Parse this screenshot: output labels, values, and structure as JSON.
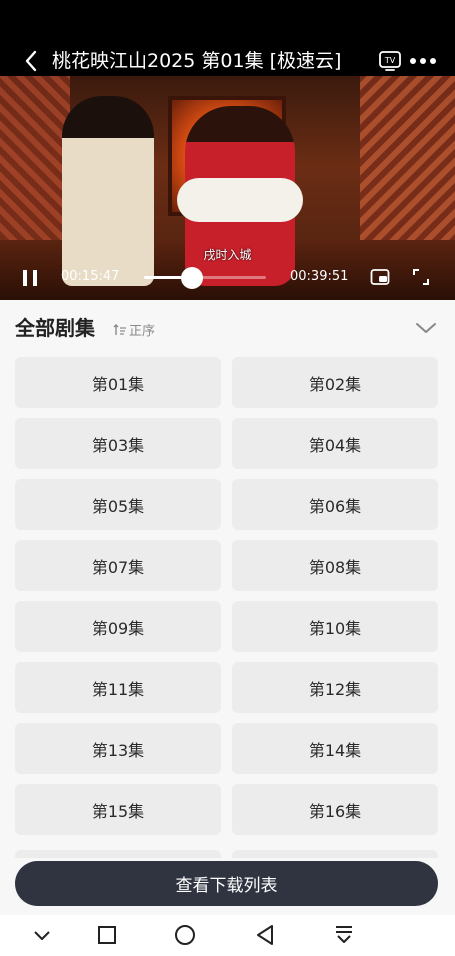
{
  "player": {
    "title": "桃花映江山2025 第01集 [极速云]",
    "subtitle_text": "戌时入城",
    "current_time": "00:15:47",
    "total_time": "00:39:51",
    "progress_fraction": 0.396,
    "icons": {
      "back": "chevron-left-icon",
      "tv": "tv-cast-icon",
      "more": "more-dots-icon",
      "pause": "pause-icon",
      "pip": "picture-in-picture-icon",
      "fullscreen": "fullscreen-icon"
    }
  },
  "episodes": {
    "header": "全部剧集",
    "sort_label": "正序",
    "items": [
      {
        "label": "第01集"
      },
      {
        "label": "第02集"
      },
      {
        "label": "第03集"
      },
      {
        "label": "第04集"
      },
      {
        "label": "第05集"
      },
      {
        "label": "第06集"
      },
      {
        "label": "第07集"
      },
      {
        "label": "第08集"
      },
      {
        "label": "第09集"
      },
      {
        "label": "第10集"
      },
      {
        "label": "第11集"
      },
      {
        "label": "第12集"
      },
      {
        "label": "第13集"
      },
      {
        "label": "第14集"
      },
      {
        "label": "第15集"
      },
      {
        "label": "第16集"
      }
    ],
    "download_label": "查看下载列表"
  },
  "navbar": {
    "icons": [
      "chevron-down-icon",
      "square-icon",
      "circle-icon",
      "triangle-back-icon",
      "download-tray-icon"
    ]
  },
  "colors": {
    "player_bg": "#000000",
    "page_bg": "#f7f7f7",
    "episode_button_bg": "#ececec",
    "download_button_bg": "#2f3440",
    "sort_text": "#8a8a8a"
  }
}
